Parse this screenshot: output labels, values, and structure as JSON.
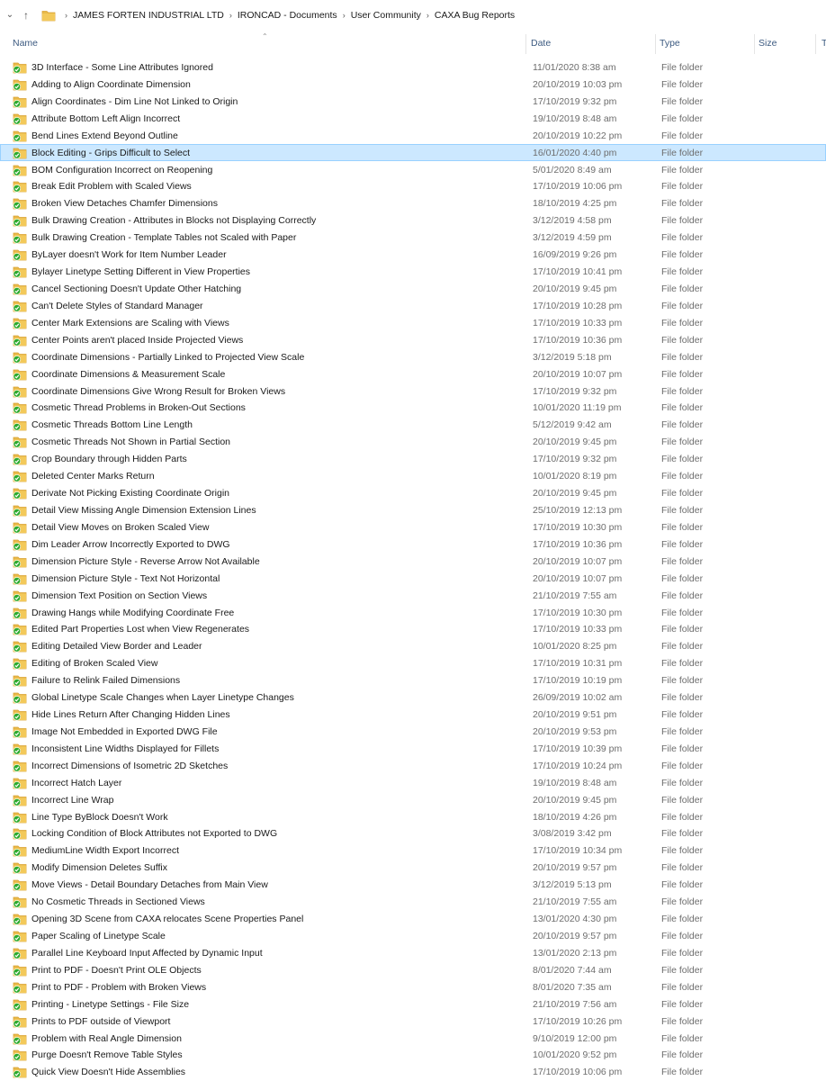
{
  "breadcrumb": [
    "JAMES FORTEN INDUSTRIAL LTD",
    "IRONCAD - Documents",
    "User Community",
    "CAXA Bug Reports"
  ],
  "columns": {
    "name": "Name",
    "date": "Date",
    "type": "Type",
    "size": "Size",
    "extra": "T"
  },
  "colors": {
    "folder": "#e8b94a",
    "folder_dark": "#d9a233",
    "sync_check": "#2eab2e",
    "selected_bg": "#cce8ff",
    "selected_border": "#99d1ff",
    "header_text": "#3c5a80"
  },
  "icons": {
    "folder": "folder-icon",
    "sync": "sync-status-check-icon"
  },
  "selected_index": 5,
  "files": [
    {
      "name": "3D Interface - Some Line Attributes Ignored",
      "date": "11/01/2020 8:38 am",
      "type": "File folder"
    },
    {
      "name": "Adding to Align Coordinate Dimension",
      "date": "20/10/2019 10:03 pm",
      "type": "File folder"
    },
    {
      "name": "Align Coordinates - Dim Line Not Linked to Origin",
      "date": "17/10/2019 9:32 pm",
      "type": "File folder"
    },
    {
      "name": "Attribute Bottom Left Align Incorrect",
      "date": "19/10/2019 8:48 am",
      "type": "File folder"
    },
    {
      "name": "Bend Lines Extend Beyond Outline",
      "date": "20/10/2019 10:22 pm",
      "type": "File folder"
    },
    {
      "name": "Block Editing - Grips Difficult to Select",
      "date": "16/01/2020 4:40 pm",
      "type": "File folder"
    },
    {
      "name": "BOM Configuration Incorrect on Reopening",
      "date": "5/01/2020 8:49 am",
      "type": "File folder"
    },
    {
      "name": "Break Edit Problem with Scaled Views",
      "date": "17/10/2019 10:06 pm",
      "type": "File folder"
    },
    {
      "name": "Broken View Detaches Chamfer Dimensions",
      "date": "18/10/2019 4:25 pm",
      "type": "File folder"
    },
    {
      "name": "Bulk Drawing Creation - Attributes in Blocks not Displaying Correctly",
      "date": "3/12/2019 4:58 pm",
      "type": "File folder"
    },
    {
      "name": "Bulk Drawing Creation - Template Tables not Scaled with Paper",
      "date": "3/12/2019 4:59 pm",
      "type": "File folder"
    },
    {
      "name": "ByLayer doesn't Work for Item Number Leader",
      "date": "16/09/2019 9:26 pm",
      "type": "File folder"
    },
    {
      "name": "Bylayer Linetype Setting Different in View Properties",
      "date": "17/10/2019 10:41 pm",
      "type": "File folder"
    },
    {
      "name": "Cancel Sectioning Doesn't Update Other Hatching",
      "date": "20/10/2019 9:45 pm",
      "type": "File folder"
    },
    {
      "name": "Can't Delete Styles of Standard Manager",
      "date": "17/10/2019 10:28 pm",
      "type": "File folder"
    },
    {
      "name": "Center Mark Extensions are Scaling with Views",
      "date": "17/10/2019 10:33 pm",
      "type": "File folder"
    },
    {
      "name": "Center Points aren't placed Inside Projected Views",
      "date": "17/10/2019 10:36 pm",
      "type": "File folder"
    },
    {
      "name": "Coordinate Dimensions - Partially Linked to Projected View Scale",
      "date": "3/12/2019 5:18 pm",
      "type": "File folder"
    },
    {
      "name": "Coordinate Dimensions & Measurement Scale",
      "date": "20/10/2019 10:07 pm",
      "type": "File folder"
    },
    {
      "name": "Coordinate Dimensions Give Wrong Result for Broken Views",
      "date": "17/10/2019 9:32 pm",
      "type": "File folder"
    },
    {
      "name": "Cosmetic Thread Problems in Broken-Out Sections",
      "date": "10/01/2020 11:19 pm",
      "type": "File folder"
    },
    {
      "name": "Cosmetic Threads Bottom Line Length",
      "date": "5/12/2019 9:42 am",
      "type": "File folder"
    },
    {
      "name": "Cosmetic Threads Not Shown in Partial Section",
      "date": "20/10/2019 9:45 pm",
      "type": "File folder"
    },
    {
      "name": "Crop Boundary through Hidden Parts",
      "date": "17/10/2019 9:32 pm",
      "type": "File folder"
    },
    {
      "name": "Deleted Center Marks Return",
      "date": "10/01/2020 8:19 pm",
      "type": "File folder"
    },
    {
      "name": "Derivate Not Picking Existing Coordinate Origin",
      "date": "20/10/2019 9:45 pm",
      "type": "File folder"
    },
    {
      "name": "Detail View Missing Angle Dimension Extension Lines",
      "date": "25/10/2019 12:13 pm",
      "type": "File folder"
    },
    {
      "name": "Detail View Moves on Broken Scaled View",
      "date": "17/10/2019 10:30 pm",
      "type": "File folder"
    },
    {
      "name": "Dim Leader Arrow Incorrectly Exported to DWG",
      "date": "17/10/2019 10:36 pm",
      "type": "File folder"
    },
    {
      "name": "Dimension Picture Style - Reverse Arrow Not Available",
      "date": "20/10/2019 10:07 pm",
      "type": "File folder"
    },
    {
      "name": "Dimension Picture Style - Text Not Horizontal",
      "date": "20/10/2019 10:07 pm",
      "type": "File folder"
    },
    {
      "name": "Dimension Text Position on Section Views",
      "date": "21/10/2019 7:55 am",
      "type": "File folder"
    },
    {
      "name": "Drawing Hangs while Modifying Coordinate Free",
      "date": "17/10/2019 10:30 pm",
      "type": "File folder"
    },
    {
      "name": "Edited Part Properties Lost when View Regenerates",
      "date": "17/10/2019 10:33 pm",
      "type": "File folder"
    },
    {
      "name": "Editing Detailed View Border and Leader",
      "date": "10/01/2020 8:25 pm",
      "type": "File folder"
    },
    {
      "name": "Editing of Broken Scaled View",
      "date": "17/10/2019 10:31 pm",
      "type": "File folder"
    },
    {
      "name": "Failure to Relink Failed Dimensions",
      "date": "17/10/2019 10:19 pm",
      "type": "File folder"
    },
    {
      "name": "Global Linetype Scale Changes when Layer Linetype Changes",
      "date": "26/09/2019 10:02 am",
      "type": "File folder"
    },
    {
      "name": "Hide Lines Return After Changing Hidden Lines",
      "date": "20/10/2019 9:51 pm",
      "type": "File folder"
    },
    {
      "name": "Image Not Embedded in Exported DWG File",
      "date": "20/10/2019 9:53 pm",
      "type": "File folder"
    },
    {
      "name": "Inconsistent Line Widths Displayed for Fillets",
      "date": "17/10/2019 10:39 pm",
      "type": "File folder"
    },
    {
      "name": "Incorrect Dimensions of Isometric 2D Sketches",
      "date": "17/10/2019 10:24 pm",
      "type": "File folder"
    },
    {
      "name": "Incorrect Hatch Layer",
      "date": "19/10/2019 8:48 am",
      "type": "File folder"
    },
    {
      "name": "Incorrect Line Wrap",
      "date": "20/10/2019 9:45 pm",
      "type": "File folder"
    },
    {
      "name": "Line Type ByBlock Doesn't Work",
      "date": "18/10/2019 4:26 pm",
      "type": "File folder"
    },
    {
      "name": "Locking Condition of Block Attributes not Exported to DWG",
      "date": "3/08/2019 3:42 pm",
      "type": "File folder"
    },
    {
      "name": "MediumLine Width Export Incorrect",
      "date": "17/10/2019 10:34 pm",
      "type": "File folder"
    },
    {
      "name": "Modify Dimension Deletes Suffix",
      "date": "20/10/2019 9:57 pm",
      "type": "File folder"
    },
    {
      "name": "Move Views - Detail Boundary Detaches from Main View",
      "date": "3/12/2019 5:13 pm",
      "type": "File folder"
    },
    {
      "name": "No Cosmetic Threads in Sectioned Views",
      "date": "21/10/2019 7:55 am",
      "type": "File folder"
    },
    {
      "name": "Opening 3D Scene from CAXA relocates Scene Properties Panel",
      "date": "13/01/2020 4:30 pm",
      "type": "File folder"
    },
    {
      "name": "Paper Scaling of Linetype Scale",
      "date": "20/10/2019 9:57 pm",
      "type": "File folder"
    },
    {
      "name": "Parallel Line Keyboard Input Affected by Dynamic Input",
      "date": "13/01/2020 2:13 pm",
      "type": "File folder"
    },
    {
      "name": "Print to PDF - Doesn't Print OLE Objects",
      "date": "8/01/2020 7:44 am",
      "type": "File folder"
    },
    {
      "name": "Print to PDF - Problem with Broken Views",
      "date": "8/01/2020 7:35 am",
      "type": "File folder"
    },
    {
      "name": "Printing - Linetype Settings - File Size",
      "date": "21/10/2019 7:56 am",
      "type": "File folder"
    },
    {
      "name": "Prints to PDF outside of Viewport",
      "date": "17/10/2019 10:26 pm",
      "type": "File folder"
    },
    {
      "name": "Problem with Real Angle Dimension",
      "date": "9/10/2019 12:00 pm",
      "type": "File folder"
    },
    {
      "name": "Purge Doesn't Remove Table Styles",
      "date": "10/01/2020 9:52 pm",
      "type": "File folder"
    },
    {
      "name": "Quick View Doesn't Hide Assemblies",
      "date": "17/10/2019 10:06 pm",
      "type": "File folder"
    }
  ]
}
